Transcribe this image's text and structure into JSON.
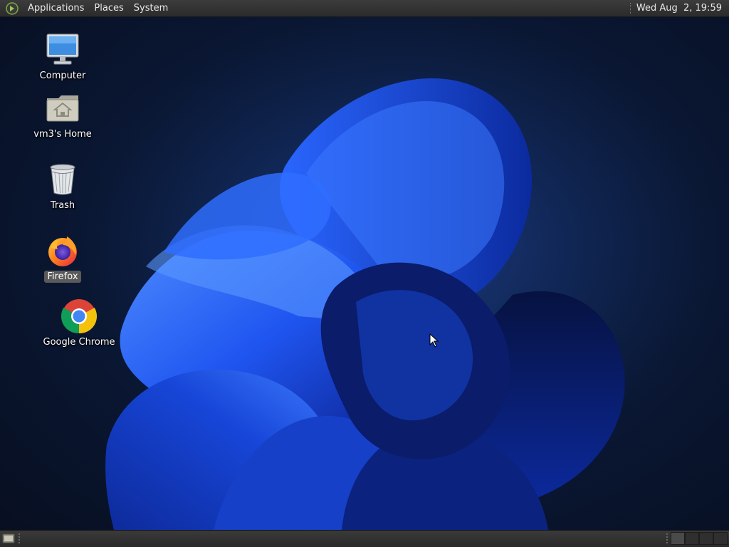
{
  "top_panel": {
    "menus": [
      "Applications",
      "Places",
      "System"
    ],
    "clock": "Wed Aug  2, 19:59"
  },
  "desktop_icons": [
    {
      "label": "Computer",
      "icon": "computer-icon"
    },
    {
      "label": "vm3's Home",
      "icon": "home-folder-icon"
    },
    {
      "label": "Trash",
      "icon": "trash-icon"
    },
    {
      "label": "Firefox",
      "icon": "firefox-icon",
      "selected": true
    },
    {
      "label": "Google Chrome",
      "icon": "chrome-icon"
    }
  ],
  "bottom_panel": {
    "show_desktop_icon": "show-desktop-icon",
    "workspaces": 4,
    "active_workspace": 1
  },
  "colors": {
    "panel": "#2f2f2f",
    "wallpaper_dark": "#0a1733",
    "bloom_blue": "#1e5bff"
  }
}
